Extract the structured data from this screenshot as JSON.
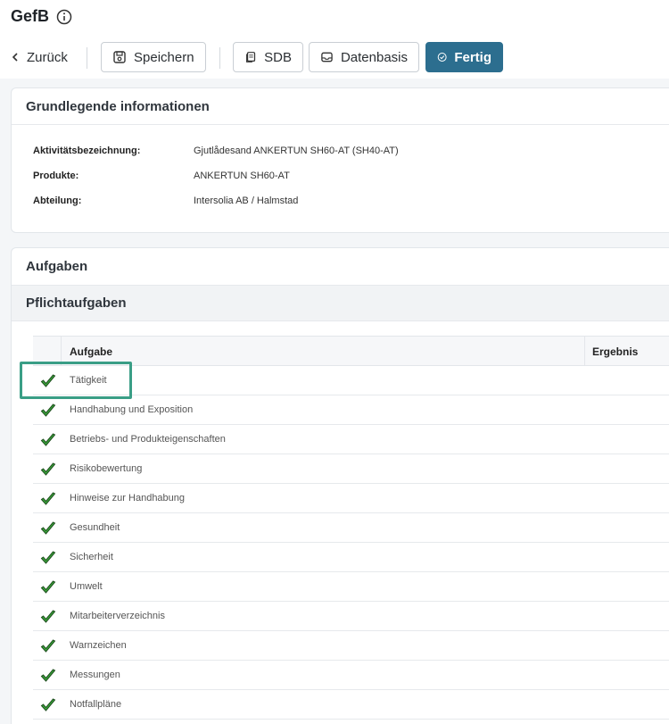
{
  "header": {
    "title": "GefB",
    "back_label": "Zurück",
    "buttons": {
      "save": "Speichern",
      "sdb": "SDB",
      "datenbasis": "Datenbasis",
      "fertig": "Fertig"
    }
  },
  "info_card": {
    "title": "Grundlegende informationen",
    "rows": [
      {
        "label": "Aktivitätsbezeichnung:",
        "value": "Gjutlådesand ANKERTUN SH60-AT (SH40-AT)"
      },
      {
        "label": "Produkte:",
        "value": "ANKERTUN SH60-AT"
      },
      {
        "label": "Abteilung:",
        "value": "Intersolia AB / Halmstad"
      }
    ]
  },
  "tasks_card": {
    "title": "Aufgaben",
    "section_title": "Pflichtaufgaben",
    "columns": {
      "task": "Aufgabe",
      "result": "Ergebnis"
    },
    "rows": [
      {
        "label": "Tätigkeit"
      },
      {
        "label": "Handhabung und Exposition"
      },
      {
        "label": "Betriebs- und Produkteigenschaften"
      },
      {
        "label": "Risikobewertung"
      },
      {
        "label": "Hinweise zur Handhabung"
      },
      {
        "label": "Gesundheit"
      },
      {
        "label": "Sicherheit"
      },
      {
        "label": "Umwelt"
      },
      {
        "label": "Mitarbeiterverzeichnis"
      },
      {
        "label": "Warnzeichen"
      },
      {
        "label": "Messungen"
      },
      {
        "label": "Notfallpläne"
      }
    ]
  },
  "colors": {
    "primary": "#2c6e8f",
    "check": "#3aa63a",
    "highlight": "#3a9e86"
  }
}
